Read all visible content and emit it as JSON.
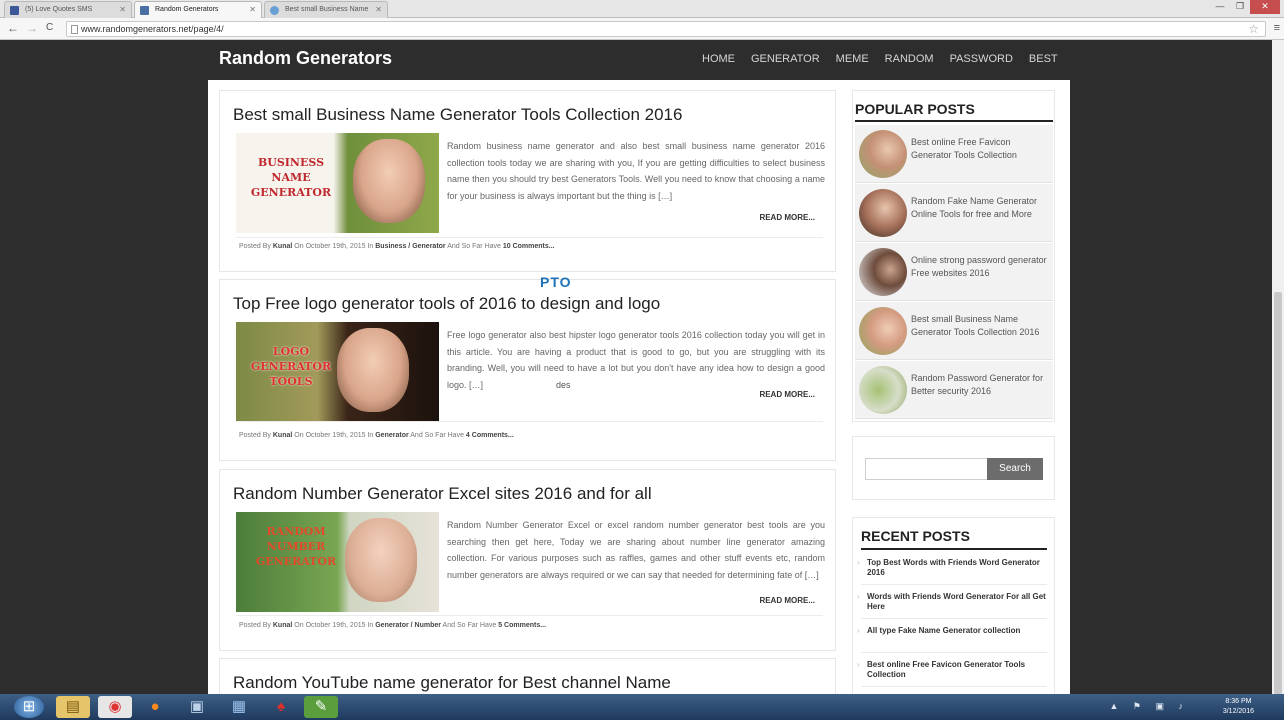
{
  "browser": {
    "tabs": [
      {
        "label": "(5) Love Quotes SMS",
        "active": false,
        "icon": "facebook-icon"
      },
      {
        "label": "Random Generators",
        "active": true,
        "icon": "site-icon"
      },
      {
        "label": "Best small Business Name",
        "active": false,
        "icon": "globe-icon"
      }
    ],
    "url": "www.randomgenerators.net/page/4/",
    "back": "←",
    "forward": "→",
    "reload": "C",
    "star": "☆",
    "menu": "≡",
    "win_min": "—",
    "win_max": "❐",
    "win_close": "✕"
  },
  "site": {
    "title": "Random Generators",
    "nav": [
      "HOME",
      "GENERATOR",
      "MEME",
      "RANDOM",
      "PASSWORD",
      "BEST"
    ]
  },
  "posts": [
    {
      "title": "Best small Business Name Generator Tools Collection 2016",
      "thumb_label": "BUSINESS NAME GENERATOR",
      "excerpt": "Random business name generator and also best small business name generator 2016 collection tools today we are sharing with you, If you are getting difficulties to select business name then you should try best Generators Tools. Well you need to know that choosing a name for your business is always important but the thing is […]",
      "read_more": "READ MORE...",
      "meta_prefix": "Posted By",
      "author": "Kunal",
      "date_text": "On October 19th, 2015 In",
      "categories": "Business / Generator",
      "comments_prefix": "And So Far Have",
      "comments": "10 Comments..."
    },
    {
      "title": "Top Free logo generator tools of 2016 to design and logo",
      "thumb_label": "LOGO GENERATOR TOOLS",
      "excerpt": "Free logo generator also best hipster logo generator tools 2016 collection today you will get in this article. You are having a product that is good to go, but you are struggling with its branding. Well, you will need to have a lot but you don't have any idea how to design a good logo. […]",
      "read_more": "READ MORE...",
      "meta_prefix": "Posted By",
      "author": "Kunal",
      "date_text": "On October 19th, 2015 In",
      "categories": "Generator",
      "comments_prefix": "And So Far Have",
      "comments": "4 Comments..."
    },
    {
      "title": "Random Number Generator Excel sites 2016 and for all",
      "thumb_label": "RANDOM NUMBER GENERATOR",
      "excerpt": "Random Number Generator Excel or excel random number generator best tools are you searching then get here, Today we are sharing about number line generator amazing collection. For various purposes such as raffles, games and other stuff events etc, random number generators are always required or we can say that needed for determining fate of […]",
      "read_more": "READ MORE...",
      "meta_prefix": "Posted By",
      "author": "Kunal",
      "date_text": "On October 19th, 2015 In",
      "categories": "Generator / Number",
      "comments_prefix": "And So Far Have",
      "comments": "5 Comments..."
    },
    {
      "title": "Random YouTube name generator for Best channel Name"
    }
  ],
  "sidebar": {
    "popular_title": "POPULAR POSTS",
    "popular": [
      "Best online Free Favicon Generator Tools Collection",
      "Random Fake Name Generator Online Tools for free and More",
      "Online strong password generator Free websites 2016",
      "Best small Business Name Generator Tools Collection 2016",
      "Random Password Generator for Better security 2016"
    ],
    "search_placeholder": "",
    "search_button": "Search",
    "recent_title": "RECENT POSTS",
    "recent": [
      "Top Best Words with Friends Word Generator 2016",
      "Words with Friends Word Generator For all Get Here",
      "All type Fake Name Generator collection",
      "Best online Free Favicon Generator Tools Collection"
    ]
  },
  "overlay": {
    "text1": "PTO",
    "text2": "des"
  },
  "taskbar": {
    "time": "8:36 PM",
    "date": "3/12/2016",
    "tray": "▲ ⚑ ▣ ♪",
    "apps": [
      "start-icon",
      "folder-icon",
      "chrome-icon",
      "firefox-icon",
      "network-icon",
      "window-icon",
      "game-icon",
      "app-icon"
    ]
  },
  "colors": {
    "page_bg": "#2d2d2d",
    "content_bg": "#ffffff",
    "search_button": "#6c6c6c",
    "taskbar": "#2b4a70"
  }
}
